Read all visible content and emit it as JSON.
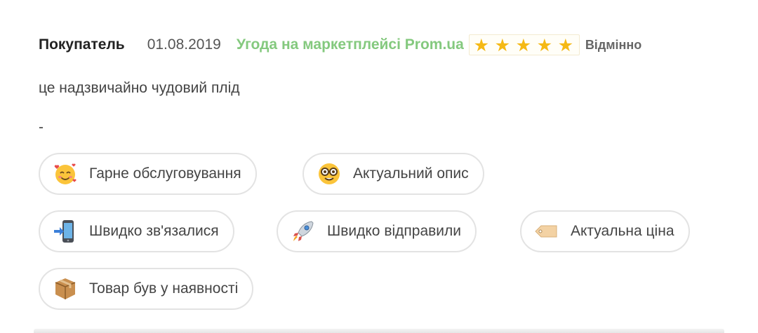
{
  "review": {
    "author": "Покупатель",
    "date": "01.08.2019",
    "deal_text": "Угода на маркетплейсі Prom.ua",
    "rating": {
      "value": 5,
      "max": 5,
      "label": "Відмінно",
      "star_color": "#f5b915"
    },
    "comment": "це надзвичайно чудовий плід",
    "extra": "-"
  },
  "tags": [
    {
      "icon": "smiling-face-with-hearts-icon",
      "label": "Гарне обслуговування"
    },
    {
      "icon": "nerd-face-icon",
      "label": "Актуальний опис"
    },
    {
      "icon": "mobile-phone-arrow-icon",
      "label": "Швидко зв'язалися"
    },
    {
      "icon": "rocket-icon",
      "label": "Швидко відправили"
    },
    {
      "icon": "price-tag-icon",
      "label": "Актуальна ціна"
    },
    {
      "icon": "package-icon",
      "label": "Товар був у наявності"
    }
  ],
  "colors": {
    "deal_green": "#84c97e",
    "chip_border": "#e3e3e3"
  }
}
